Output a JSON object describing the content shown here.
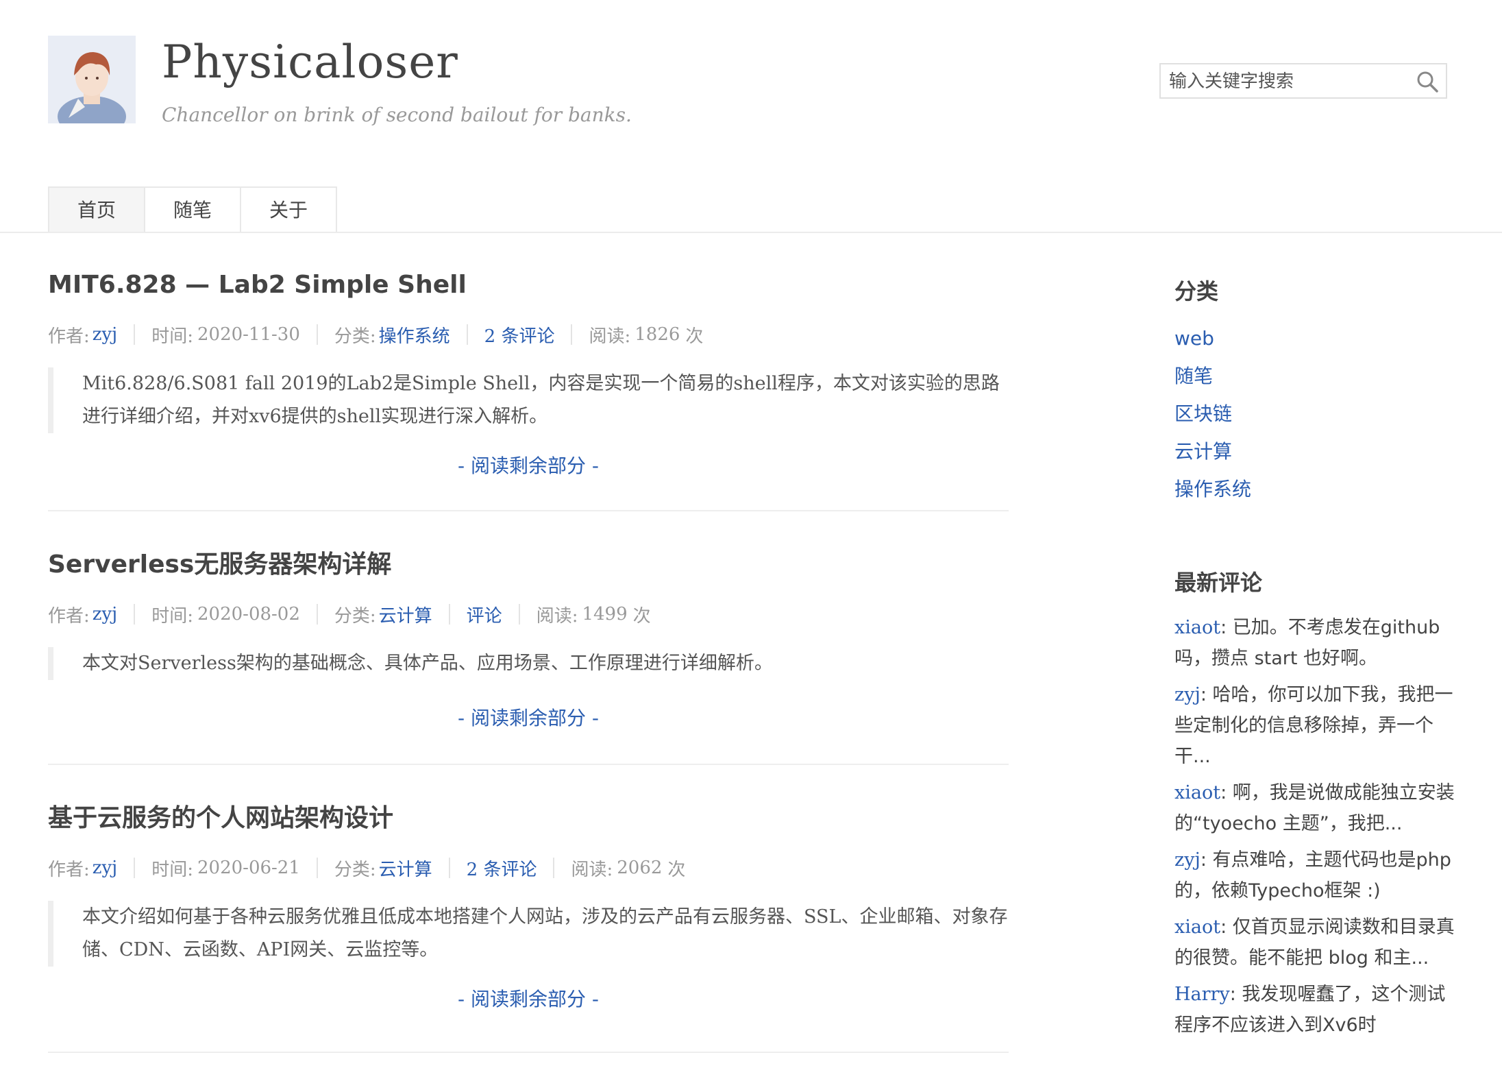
{
  "site": {
    "title": "Physicaloser",
    "description": "Chancellor on brink of second bailout for banks."
  },
  "search": {
    "placeholder": "输入关键字搜索"
  },
  "nav": {
    "items": [
      "首页",
      "随笔",
      "关于"
    ],
    "active": "首页"
  },
  "labels": {
    "author": "作者:",
    "time": "时间:",
    "category": "分类:",
    "read": "阅读:",
    "times_suffix": "次",
    "read_more": "- 阅读剩余部分 -"
  },
  "posts": [
    {
      "title": "MIT6.828 — Lab2 Simple Shell",
      "author": "zyj",
      "date": "2020-11-30",
      "category": "操作系统",
      "comments": "2 条评论",
      "views": "1826",
      "excerpt": "Mit6.828/6.S081 fall 2019的Lab2是Simple Shell，内容是实现一个简易的shell程序，本文对该实验的思路进行详细介绍，并对xv6提供的shell实现进行深入解析。"
    },
    {
      "title": "Serverless无服务器架构详解",
      "author": "zyj",
      "date": "2020-08-02",
      "category": "云计算",
      "comments": "评论",
      "views": "1499",
      "excerpt": "本文对Serverless架构的基础概念、具体产品、应用场景、工作原理进行详细解析。"
    },
    {
      "title": "基于云服务的个人网站架构设计",
      "author": "zyj",
      "date": "2020-06-21",
      "category": "云计算",
      "comments": "2 条评论",
      "views": "2062",
      "excerpt": "本文介绍如何基于各种云服务优雅且低成本地搭建个人网站，涉及的云产品有云服务器、SSL、企业邮箱、对象存储、CDN、云函数、API网关、云监控等。"
    }
  ],
  "sidebar": {
    "categories_title": "分类",
    "categories": [
      "web",
      "随笔",
      "区块链",
      "云计算",
      "操作系统"
    ],
    "comments_title": "最新评论",
    "recent_comments": [
      {
        "author": "xiaot",
        "text": ": 已加。不考虑发在github 吗，攒点 start 也好啊。"
      },
      {
        "author": "zyj",
        "text": ": 哈哈，你可以加下我，我把一些定制化的信息移除掉，弄一个干..."
      },
      {
        "author": "xiaot",
        "text": ": 啊，我是说做成能独立安装的“tyoecho 主题”，我把..."
      },
      {
        "author": "zyj",
        "text": ": 有点难哈，主题代码也是php的，依赖Typecho框架 :)"
      },
      {
        "author": "xiaot",
        "text": ": 仅首页显示阅读数和目录真的很赞。能不能把 blog 和主..."
      },
      {
        "author": "Harry",
        "text": ": 我发现喔蠢了，这个测试程序不应该进入到Xv6时"
      }
    ]
  },
  "colors": {
    "link": "#2a5db0",
    "text": "#444444",
    "muted": "#999999"
  }
}
